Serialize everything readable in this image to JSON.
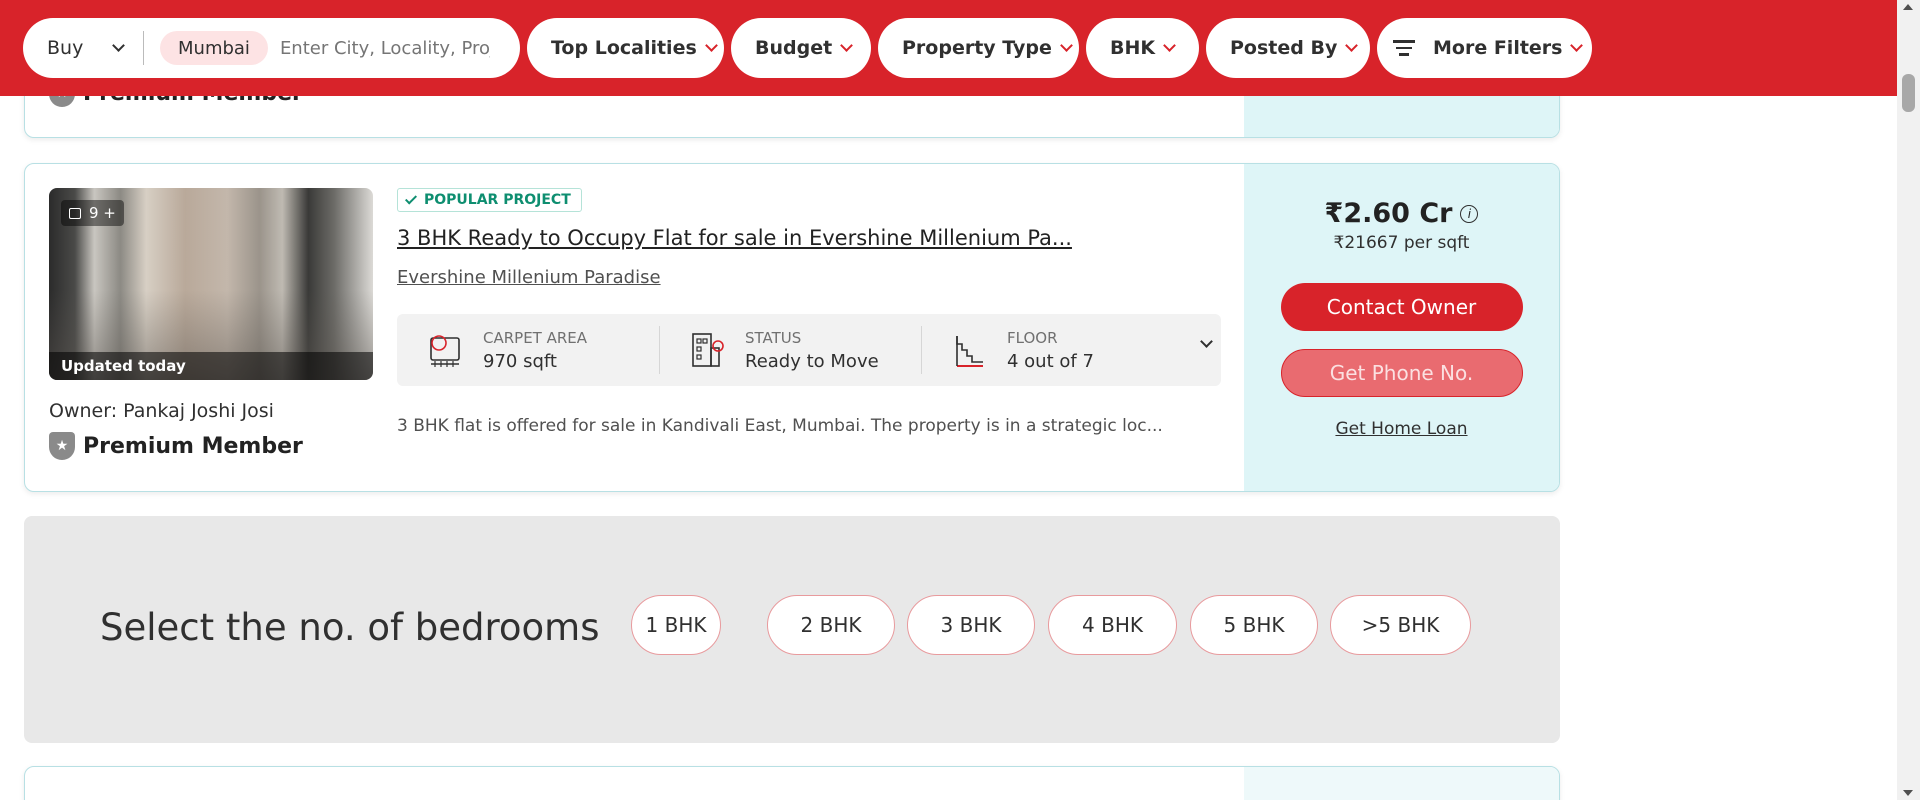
{
  "filters": {
    "transaction": "Buy",
    "city_chip": "Mumbai",
    "search_placeholder": "Enter City, Locality, Project",
    "top_localities": "Top Localities",
    "budget": "Budget",
    "property_type": "Property Type",
    "bhk": "BHK",
    "posted_by": "Posted By",
    "more_filters": "More Filters"
  },
  "previous_card": {
    "member_label": "Premium Member"
  },
  "listing": {
    "photo_count": "9 +",
    "updated": "Updated today",
    "owner": "Owner: Pankaj Joshi Josi",
    "member_label": "Premium Member",
    "badge": "POPULAR PROJECT",
    "title": "3 BHK Ready to Occupy Flat for sale in Evershine Millenium Pa...",
    "project_name": "Evershine Millenium Paradise",
    "specs": [
      {
        "label": "CARPET AREA",
        "value": "970 sqft",
        "icon": "carpet-area-icon"
      },
      {
        "label": "STATUS",
        "value": "Ready to Move",
        "icon": "building-status-icon"
      },
      {
        "label": "FLOOR",
        "value": "4 out of 7",
        "icon": "stairs-floor-icon"
      }
    ],
    "description": "3 BHK flat is offered for sale in Kandivali East, Mumbai. The property is in a strategic loc...",
    "price": "₹2.60 Cr",
    "price_per_sqft": "₹21667 per sqft",
    "contact_button": "Contact Owner",
    "phone_button": "Get Phone No.",
    "home_loan_link": "Get Home Loan"
  },
  "bedrooms": {
    "title": "Select the no. of bedrooms",
    "options": [
      "1 BHK",
      "2 BHK",
      "3 BHK",
      "4 BHK",
      "5 BHK",
      ">5 BHK"
    ]
  },
  "colors": {
    "brand_red": "#d8232a",
    "side_panel": "#def5f7",
    "badge_green": "#0e8e70"
  }
}
